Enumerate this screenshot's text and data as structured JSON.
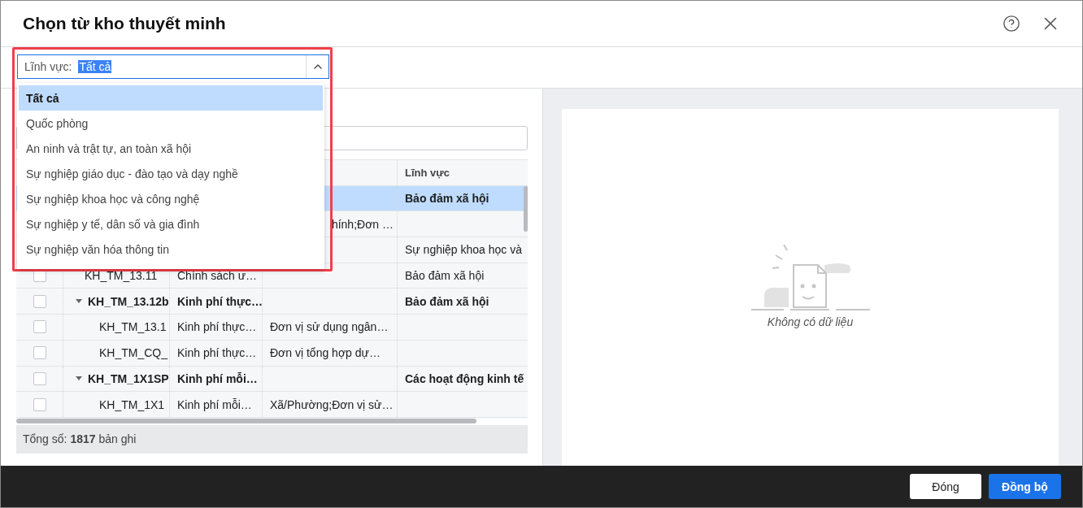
{
  "dialog": {
    "title": "Chọn từ kho thuyết minh"
  },
  "filter": {
    "label": "Lĩnh vực:",
    "value": "Tất cả",
    "expanded": true,
    "options": [
      {
        "label": "Tất cả",
        "selected": true
      },
      {
        "label": "Quốc phòng",
        "selected": false
      },
      {
        "label": "An ninh và trật tự, an toàn xã hội",
        "selected": false
      },
      {
        "label": "Sự nghiệp giáo dục - đào tạo và dạy nghề",
        "selected": false
      },
      {
        "label": "Sự nghiệp khoa học và công nghệ",
        "selected": false
      },
      {
        "label": "Sự nghiệp y tế, dân số và gia đình",
        "selected": false
      },
      {
        "label": "Sự nghiệp văn hóa thông tin",
        "selected": false
      }
    ]
  },
  "table": {
    "field_header": "Lĩnh vực",
    "rows": [
      {
        "kind": "group",
        "selected": true,
        "field": "Bảo đảm xã hội"
      },
      {
        "kind": "item",
        "selected": false,
        "unit": "hính;Đơn …",
        "unit_clipped": true
      },
      {
        "kind": "item",
        "selected": false,
        "field": "Sự nghiệp khoa học và"
      },
      {
        "kind": "item",
        "selected": false,
        "checked": false,
        "code": "KH_TM_13.11",
        "name": "Chính sách ư…",
        "field": "Bảo đảm xã hội"
      },
      {
        "kind": "group",
        "selected": false,
        "checked": false,
        "expanded": true,
        "code": "KH_TM_13.12b",
        "name": "Kinh phí thực…",
        "field": "Bảo đảm xã hội",
        "children": [
          {
            "kind": "item",
            "selected": false,
            "checked": false,
            "code": "KH_TM_13.1",
            "name": "Kinh phí thực…",
            "unit": "Đơn vị sử dụng ngân…"
          },
          {
            "kind": "item",
            "selected": false,
            "checked": false,
            "code": "KH_TM_CQ_",
            "name": "Kinh phí thực…",
            "unit": "Đơn vị tổng hợp dự…"
          }
        ]
      },
      {
        "kind": "group",
        "selected": false,
        "checked": false,
        "expanded": true,
        "code": "KH_TM_1X1SP",
        "name": "Kinh phí mỗi…",
        "field": "Các hoạt động kinh tế",
        "children": [
          {
            "kind": "item",
            "selected": false,
            "checked": false,
            "code": "KH_TM_1X1",
            "name": "Kinh phí mỗi…",
            "unit": "Xã/Phường;Đơn vị sử…"
          }
        ]
      }
    ],
    "total": "Tổng số: **1817** bản ghi"
  },
  "preview": {
    "empty_text": "Không có dữ liệu"
  },
  "buttons": [
    {
      "label": "Đóng",
      "kind": "secondary"
    },
    {
      "label": "Đồng bộ",
      "kind": "primary"
    }
  ]
}
